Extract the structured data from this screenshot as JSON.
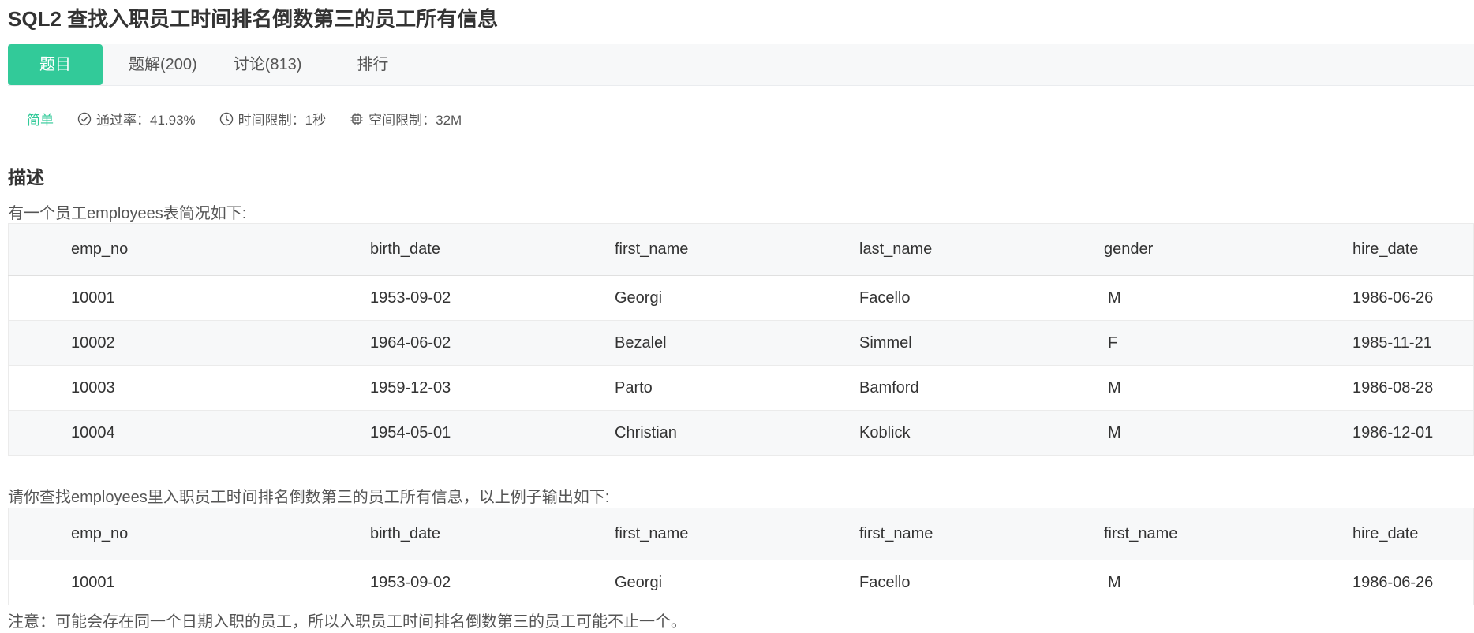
{
  "problem": {
    "title": "SQL2  查找入职员工时间排名倒数第三的员工所有信息"
  },
  "tabs": [
    {
      "label": "题目",
      "active": true
    },
    {
      "label": "题解(200)"
    },
    {
      "label": "讨论(813)"
    },
    {
      "label": "排行"
    }
  ],
  "meta": {
    "difficulty": "简单",
    "pass_rate": "通过率：41.93%",
    "time_limit": "时间限制：1秒",
    "space_limit": "空间限制：32M"
  },
  "description": {
    "heading": "描述",
    "intro": "有一个员工employees表简况如下:",
    "question": "请你查找employees里入职员工时间排名倒数第三的员工所有信息，以上例子输出如下:",
    "note": "注意：可能会存在同一个日期入职的员工，所以入职员工时间排名倒数第三的员工可能不止一个。"
  },
  "employees_table": {
    "headers": [
      "emp_no",
      "birth_date",
      "first_name",
      "last_name",
      "gender",
      "hire_date"
    ],
    "rows": [
      [
        "10001",
        "1953-09-02",
        "Georgi",
        "Facello",
        "M",
        "1986-06-26"
      ],
      [
        "10002",
        "1964-06-02",
        "Bezalel",
        "Simmel",
        "F",
        "1985-11-21"
      ],
      [
        "10003",
        "1959-12-03",
        "Parto",
        "Bamford",
        "M",
        "1986-08-28"
      ],
      [
        "10004",
        "1954-05-01",
        "Christian",
        "Koblick",
        "M",
        "1986-12-01"
      ]
    ]
  },
  "output_table": {
    "headers": [
      "emp_no",
      "birth_date",
      "first_name",
      "first_name",
      "first_name",
      "hire_date"
    ],
    "rows": [
      [
        "10001",
        "1953-09-02",
        "Georgi",
        "Facello",
        "M",
        "1986-06-26"
      ]
    ]
  },
  "colors": {
    "accent": "#32ca99",
    "tab_bar_bg": "#f7f8f9",
    "text": "#333333"
  }
}
